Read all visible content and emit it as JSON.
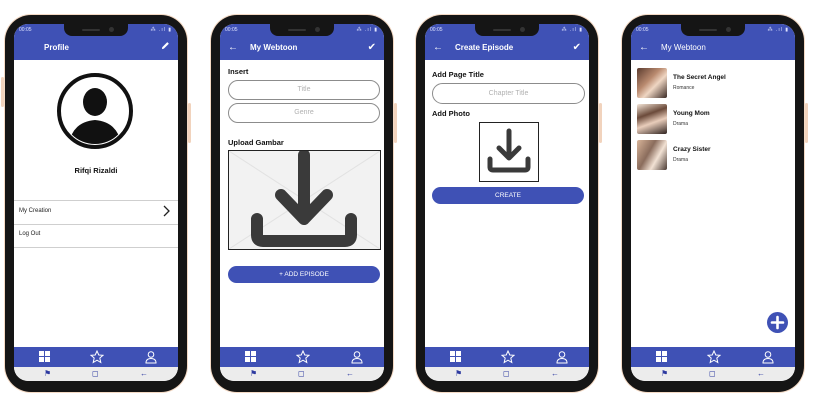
{
  "statusbar": {
    "time": "00:05",
    "signal": "⁂ .ıl ▮"
  },
  "screens": {
    "profile": {
      "title": "Profile",
      "user_name": "Rifqi Rizaldi",
      "menu": [
        "My Creation",
        "Log Out"
      ]
    },
    "my_webtoon_form": {
      "title": "My Webtoon",
      "insert_label": "Insert",
      "title_placeholder": "Title",
      "genre_placeholder": "Genre",
      "upload_label": "Upload Gambar",
      "add_episode_label": "+ ADD EPISODE"
    },
    "create_episode": {
      "title": "Create Episode",
      "page_title_label": "Add Page Title",
      "page_title_placeholder": "Chapter Title",
      "photo_label": "Add Photo",
      "create_label": "CREATE"
    },
    "my_webtoon_list": {
      "title": "My Webtoon",
      "items": [
        {
          "title": "The Secret Angel",
          "genre": "Romance"
        },
        {
          "title": "Young Mom",
          "genre": "Drama"
        },
        {
          "title": "Crazy Sister",
          "genre": "Drama"
        }
      ]
    }
  },
  "icons": {
    "bottom_nav": [
      "grid-icon",
      "star-icon",
      "person-icon"
    ],
    "system_nav": [
      "recent-apps-icon",
      "home-icon",
      "back-icon"
    ]
  },
  "colors": {
    "primary": "#3f51b5",
    "frame": "#151515",
    "accent_outline": "#f3d9c4"
  }
}
